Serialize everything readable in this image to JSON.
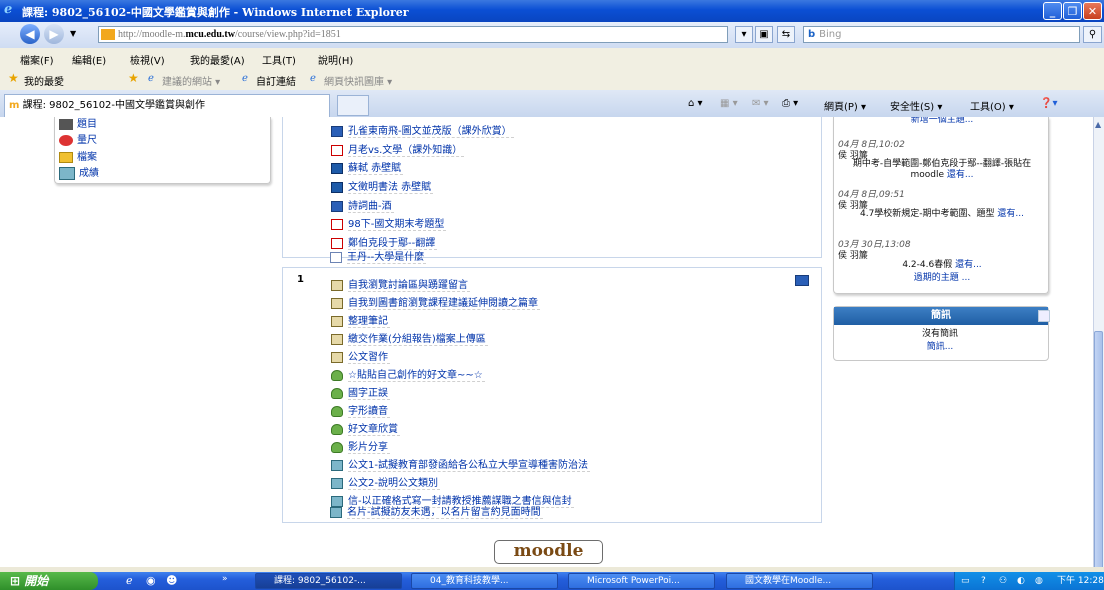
{
  "window": {
    "title": "課程: 9802_56102-中國文學鑑賞與創作 - Windows Internet Explorer",
    "controls": [
      "minimize",
      "restore",
      "close"
    ]
  },
  "address_bar": {
    "url_prefix": "http://moodle-m.",
    "url_host": "mcu.edu.tw",
    "url_path": "/course/view.php?id=1851",
    "search_placeholder": "Bing"
  },
  "menu_bar": [
    "檔案(F)",
    "編輯(E)",
    "檢視(V)",
    "我的最愛(A)",
    "工具(T)",
    "說明(H)"
  ],
  "favorites_bar": {
    "favorites_label": "我的最愛",
    "suggested": "建議的網站 ▾",
    "custom_links": "自訂連結",
    "web_slice": "網頁快訊圖庫 ▾"
  },
  "tab": {
    "label": "課程: 9802_56102-中國文學鑑賞與創作"
  },
  "toolbar": {
    "page": "網頁(P) ▾",
    "safety": "安全性(S) ▾",
    "tools": "工具(O) ▾"
  },
  "left_block": {
    "items": [
      "題目",
      "量尺",
      "檔案",
      "成績"
    ]
  },
  "section_a": {
    "items": [
      {
        "icon": "word-icon",
        "label": "孔雀東南飛-圖文並茂版（課外欣賞）"
      },
      {
        "icon": "pdf-icon",
        "label": "月老vs.文學（課外知識）"
      },
      {
        "icon": "powerpoint-icon",
        "label": "蘇軾 赤壁賦"
      },
      {
        "icon": "powerpoint-icon",
        "label": "文徵明書法 赤壁賦"
      },
      {
        "icon": "word-icon",
        "label": "詩詞曲-酒"
      },
      {
        "icon": "pdf-icon",
        "label": "98下-國文期末考題型"
      },
      {
        "icon": "pdf-icon",
        "label": "鄭伯克段于鄢--翻譯"
      },
      {
        "icon": "page-icon",
        "label": "王丹--大學是什麼"
      }
    ]
  },
  "section_b": {
    "number": "1",
    "items": [
      {
        "icon": "assignment-icon",
        "label": "自我瀏覽討論區與踴躍留言"
      },
      {
        "icon": "assignment-icon",
        "label": "自我到圖書館瀏覽課程建議延伸閱讀之篇章"
      },
      {
        "icon": "assignment-icon",
        "label": "整理筆記"
      },
      {
        "icon": "assignment-icon",
        "label": "繳交作業(分組報告)檔案上傳區"
      },
      {
        "icon": "assignment-icon",
        "label": "公文習作"
      },
      {
        "icon": "forum-icon",
        "label": "☆貼貼自己創作的好文章~~☆"
      },
      {
        "icon": "forum-icon",
        "label": "國字正誤"
      },
      {
        "icon": "forum-icon",
        "label": "字形讀音"
      },
      {
        "icon": "forum-icon",
        "label": "好文章欣賞"
      },
      {
        "icon": "forum-icon",
        "label": "影片分享"
      },
      {
        "icon": "resource-icon",
        "label": "公文1-試擬教育部發函給各公私立大學宣導種害防治法"
      },
      {
        "icon": "resource-icon",
        "label": "公文2-說明公文類別"
      },
      {
        "icon": "resource-icon",
        "label": "信-以正確格式寫一封請教授推薦謀職之書信與信封"
      },
      {
        "icon": "resource-icon",
        "label": "名片-試擬訪友未遇，以名片留言約見面時間"
      }
    ]
  },
  "recent": {
    "top_link": "新增一個主題...",
    "posts": [
      {
        "date": "04月 8日,10:02",
        "author": "侯 羽簾",
        "text": "期中考-自學範圍-鄭伯克段于鄢--翻譯-張貼在moodle",
        "more": "還有..."
      },
      {
        "date": "04月 8日,09:51",
        "author": "侯 羽簾",
        "text": "4.7學校新規定-期中考範圍、題型",
        "more": "還有..."
      },
      {
        "date": "03月 30日,13:08",
        "author": "侯 羽簾",
        "text": "4.2-4.6春假",
        "more": "還有..."
      }
    ],
    "older": "過期的主題 ..."
  },
  "news": {
    "title": "簡訊",
    "empty": "沒有簡訊",
    "link": "簡訊..."
  },
  "footer": {
    "logo": "moodle"
  },
  "taskbar": {
    "start": "開始",
    "tasks": [
      {
        "label": "課程: 9802_56102-...",
        "active": true
      },
      {
        "label": "04_教育科技教學..."
      },
      {
        "label": "Microsoft PowerPoi..."
      },
      {
        "label": "國文教學在Moodle..."
      }
    ],
    "clock": "下午 12:28"
  }
}
